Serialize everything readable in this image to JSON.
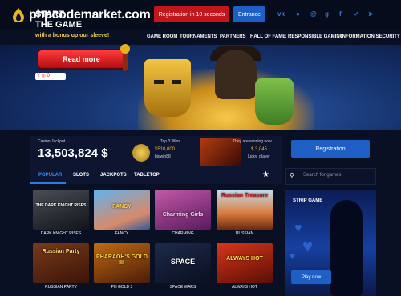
{
  "header": {
    "logo_text": "phpcodemarket.com",
    "register_button": "Registration in 10 seconds",
    "entrance_button": "Entrance",
    "social_icons": [
      "vk-icon",
      "odnoklassniki-icon",
      "mail-ru-icon",
      "google-plus-icon",
      "facebook-icon",
      "twitter-icon",
      "telegram-icon"
    ]
  },
  "nav": {
    "items": [
      "GAME ROOM",
      "TOURNAMENTS",
      "PARTNERS",
      "HALL OF FAME",
      "RESPONSIBLE GAMING",
      "INFORMATION SECURITY"
    ]
  },
  "hero": {
    "title_line1": "START",
    "title_line2": "THE GAME",
    "subtitle": "with a bonus up our sleeve!",
    "read_more": "Read more",
    "badge": "Y ◎ 0"
  },
  "jackpot": {
    "label": "Casino Jackpot",
    "value": "13,503,824 $",
    "top3_label": "Top 3 Wins",
    "top3_amount": "$510,000",
    "top3_user": "bigwin88",
    "winning_label": "They are winning now",
    "winning_amount": "$ 3,045",
    "winning_user": "lucky_player"
  },
  "tabs": [
    "POPULAR",
    "SLOTS",
    "JACKPOTS",
    "TABLETOP"
  ],
  "games": [
    {
      "name": "DARK KNIGHT RISES",
      "art": "THE DARK KNIGHT RISES"
    },
    {
      "name": "FANCY",
      "art": "FANCY"
    },
    {
      "name": "CHARMING",
      "art": "Charming Girls"
    },
    {
      "name": "RUSSIAN",
      "art": "Russian Treasure"
    },
    {
      "name": "RUSSIAN PARTY",
      "art": "Russian Party"
    },
    {
      "name": "PH GOLD 3",
      "art": "PHARAOH'S GOLD III"
    },
    {
      "name": "SPACE WARS",
      "art": "SPACE"
    },
    {
      "name": "ALWAYS HOT",
      "art": "ALWAYS HOT"
    }
  ],
  "sidebar": {
    "registration_button": "Registration",
    "search_placeholder": "Search for games",
    "promo_title": "STRIP GAME",
    "play_now": "Play now"
  },
  "colors": {
    "background": "#0a1024",
    "accent_blue": "#1d5fc4",
    "accent_red": "#c2161c",
    "gold": "#f0b534"
  }
}
